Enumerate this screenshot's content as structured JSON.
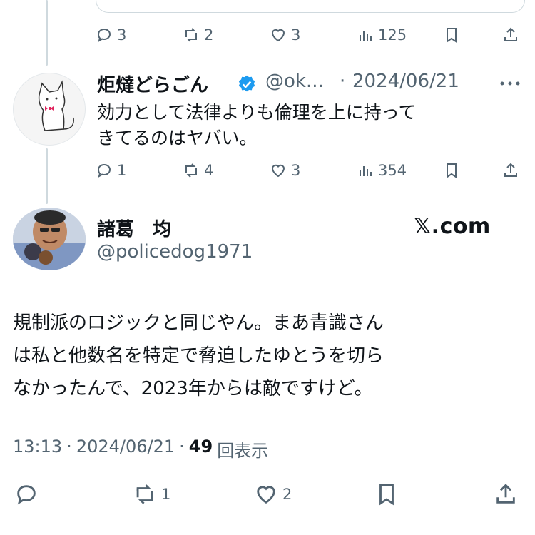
{
  "top_tweet": {
    "stats": {
      "replies": "3",
      "retweets": "2",
      "likes": "3",
      "views": "125"
    }
  },
  "reply_tweet": {
    "display_name": "炬燵どらごん",
    "handle": "@ok...",
    "separator": "·",
    "date": "2024/06/21",
    "text_line1": "効力として法律よりも倫理を上に持って",
    "text_line2": "きてるのはヤバい。",
    "stats": {
      "replies": "1",
      "retweets": "4",
      "likes": "3",
      "views": "354"
    }
  },
  "main_tweet": {
    "display_name": "諸葛　均",
    "handle": "@policedog1971",
    "x_brand": "𝕏.com",
    "text_line1": "規制派のロジックと同じやん。まあ青識さん",
    "text_line2": "は私と他数名を特定で脅迫したゆとうを切ら",
    "text_line3": "なかったんで、2023年からは敵ですけど。",
    "time": "13:13",
    "dot1": "·",
    "date": "2024/06/21",
    "dot2": "·",
    "views_count": "49",
    "views_label": "回表示",
    "stats": {
      "retweets": "1",
      "likes": "2"
    }
  },
  "icons": {
    "reply": "reply-icon",
    "retweet": "retweet-icon",
    "like": "heart-icon",
    "views": "analytics-icon",
    "bookmark": "bookmark-icon",
    "share": "share-icon",
    "verified": "verified-badge-icon",
    "more": "more-icon"
  },
  "colors": {
    "text": "#0f1419",
    "muted": "#536471",
    "verified": "#1d9bf0",
    "line": "#cfd9de"
  }
}
